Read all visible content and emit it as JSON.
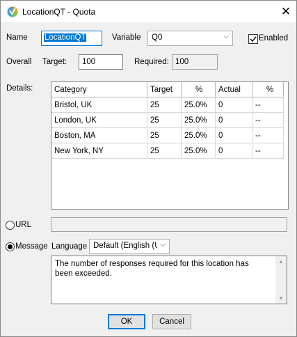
{
  "window": {
    "title": "LocationQT - Quota",
    "close_glyph": "✕"
  },
  "form": {
    "name_label": "Name",
    "name_value": "LocationQT",
    "variable_label": "Variable",
    "variable_value": "Q0",
    "enabled_label": "Enabled",
    "enabled_checked": true,
    "overall_label": "Overall",
    "target_label": "Target:",
    "target_value": "100",
    "required_label": "Required:",
    "required_value": "100",
    "details_label": "Details:"
  },
  "table": {
    "columns": [
      "Category",
      "Target",
      "%",
      "Actual",
      "%"
    ],
    "rows": [
      [
        "Bristol, UK",
        "25",
        "25.0%",
        "0",
        "--"
      ],
      [
        "London, UK",
        "25",
        "25.0%",
        "0",
        "--"
      ],
      [
        "Boston, MA",
        "25",
        "25.0%",
        "0",
        "--"
      ],
      [
        "New York, NY",
        "25",
        "25.0%",
        "0",
        "--"
      ]
    ]
  },
  "url": {
    "label": "URL",
    "value": "",
    "selected": false
  },
  "message": {
    "label": "Message",
    "selected": true,
    "language_label": "Language",
    "language_value": "Default (English (Uk",
    "text": "The number of responses required for this location has been exceeded."
  },
  "buttons": {
    "ok": "OK",
    "cancel": "Cancel"
  },
  "colors": {
    "accent": "#0078d7"
  }
}
